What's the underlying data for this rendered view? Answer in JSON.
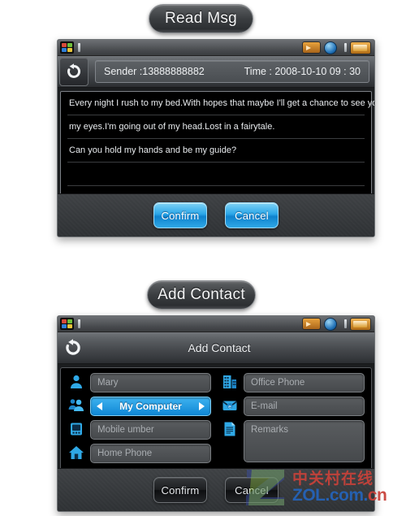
{
  "captions": {
    "read": "Read Msg",
    "add": "Add Contact"
  },
  "statusbar": {
    "start_icon": "windows-logo-icon",
    "signal_icon": "signal-bar-icon",
    "connection_icon": "connection-chip-icon",
    "globe_icon": "globe-icon",
    "battery_icon": "battery-icon"
  },
  "read_msg_screen": {
    "back_icon": "back-refresh-arrow-icon",
    "sender_label": "Sender :13888888882",
    "time_label": "Time : 2008-10-10  09 : 30",
    "message_lines": [
      "Every night I rush to my bed.With hopes that maybe I'll get a chance to see you.When i close",
      "my eyes.I'm going out of my head.Lost in a fairytale.",
      "Can you hold my hands and be my guide?",
      "",
      ""
    ],
    "confirm_label": "Confirm",
    "cancel_label": "Cancel"
  },
  "add_contact_screen": {
    "back_icon": "back-refresh-arrow-icon",
    "title": "Add Contact",
    "fields_left": [
      {
        "icon": "person-icon",
        "value": "Mary",
        "selected": false
      },
      {
        "icon": "group-icon",
        "value": "My Computer",
        "selected": true
      },
      {
        "icon": "mobile-phone-icon",
        "value": "Mobile umber",
        "selected": false
      },
      {
        "icon": "home-icon",
        "value": "Home Phone",
        "selected": false
      }
    ],
    "fields_right": [
      {
        "icon": "office-building-icon",
        "value": "Office Phone",
        "tall": false
      },
      {
        "icon": "email-icon",
        "value": "E-mail",
        "tall": false
      },
      {
        "icon": "remarks-document-icon",
        "value": "Remarks",
        "tall": true
      }
    ],
    "confirm_label": "Confirm",
    "cancel_label": "Cancel"
  },
  "watermark": {
    "chinese": "中关村在线",
    "url_main": "ZOL.com.",
    "url_suffix": "cn"
  },
  "colors": {
    "accent_blue": "#0e86d4",
    "icon_blue": "#2fa8e6",
    "battery_orange": "#e8a23c",
    "watermark_red": "#c9423a",
    "watermark_blue": "#2563b8"
  }
}
